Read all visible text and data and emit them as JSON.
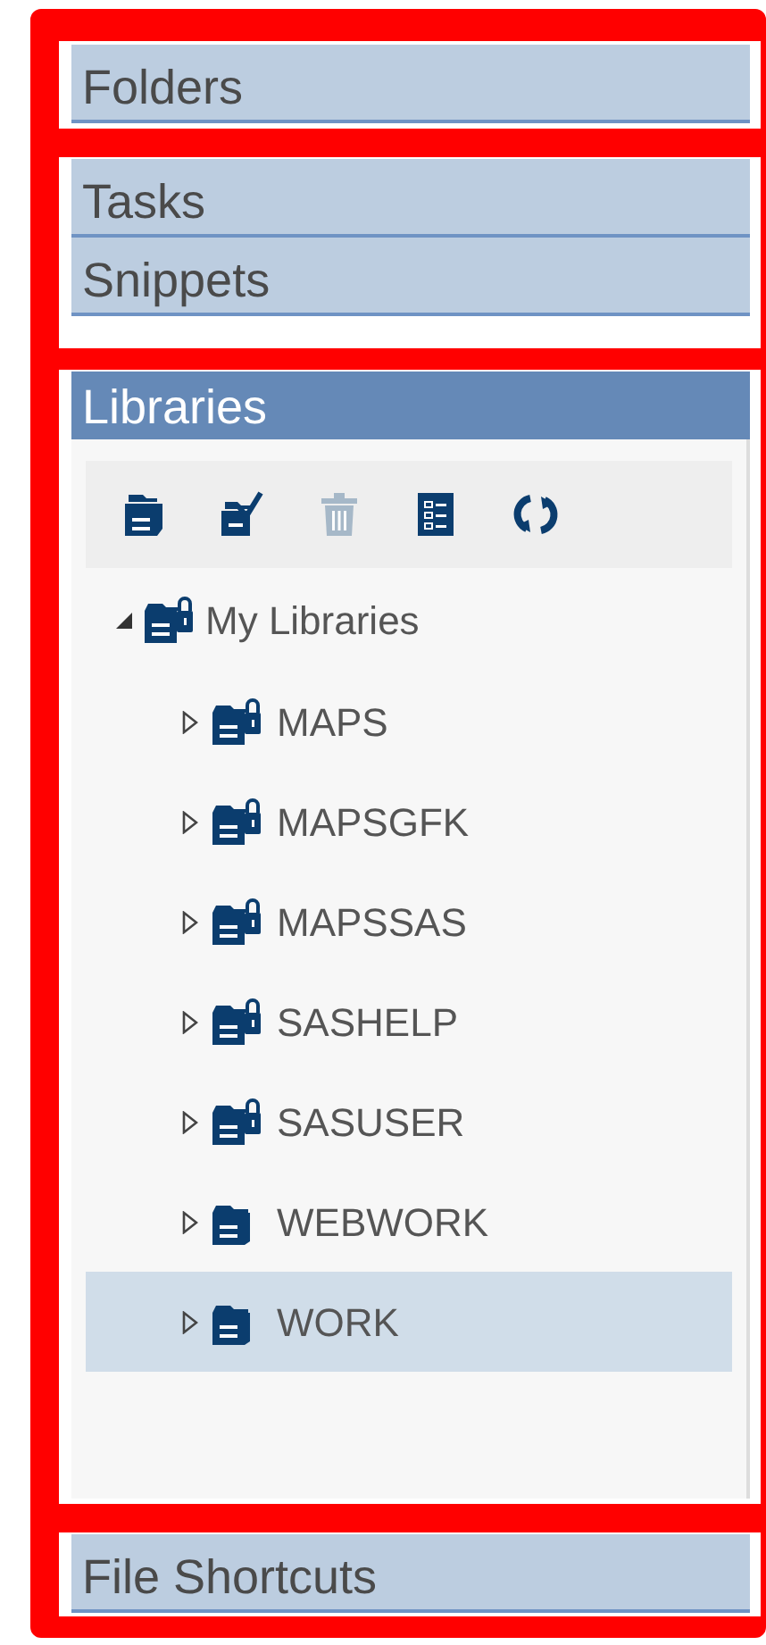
{
  "sections": [
    {
      "title": "Folders",
      "expanded": false
    },
    {
      "title": "Tasks",
      "expanded": false
    },
    {
      "title": "Snippets",
      "expanded": false
    },
    {
      "title": "Libraries",
      "expanded": true
    },
    {
      "title": "File Shortcuts",
      "expanded": false
    }
  ],
  "toolbar": [
    {
      "kind": "new",
      "disabled": false
    },
    {
      "kind": "properties",
      "disabled": false
    },
    {
      "kind": "delete",
      "disabled": true
    },
    {
      "kind": "details",
      "disabled": false
    },
    {
      "kind": "refresh",
      "disabled": false
    }
  ],
  "tree": {
    "label": "My Libraries",
    "expanded": true,
    "children": [
      {
        "label": "MAPS",
        "expanded": false,
        "read_only": true,
        "selected": false
      },
      {
        "label": "MAPSGFK",
        "expanded": false,
        "read_only": true,
        "selected": false
      },
      {
        "label": "MAPSSAS",
        "expanded": false,
        "read_only": true,
        "selected": false
      },
      {
        "label": "SASHELP",
        "expanded": false,
        "read_only": true,
        "selected": false
      },
      {
        "label": "SASUSER",
        "expanded": false,
        "read_only": true,
        "selected": false
      },
      {
        "label": "WEBWORK",
        "expanded": false,
        "read_only": false,
        "selected": false
      },
      {
        "label": "WORK",
        "expanded": false,
        "read_only": false,
        "selected": true
      }
    ]
  }
}
